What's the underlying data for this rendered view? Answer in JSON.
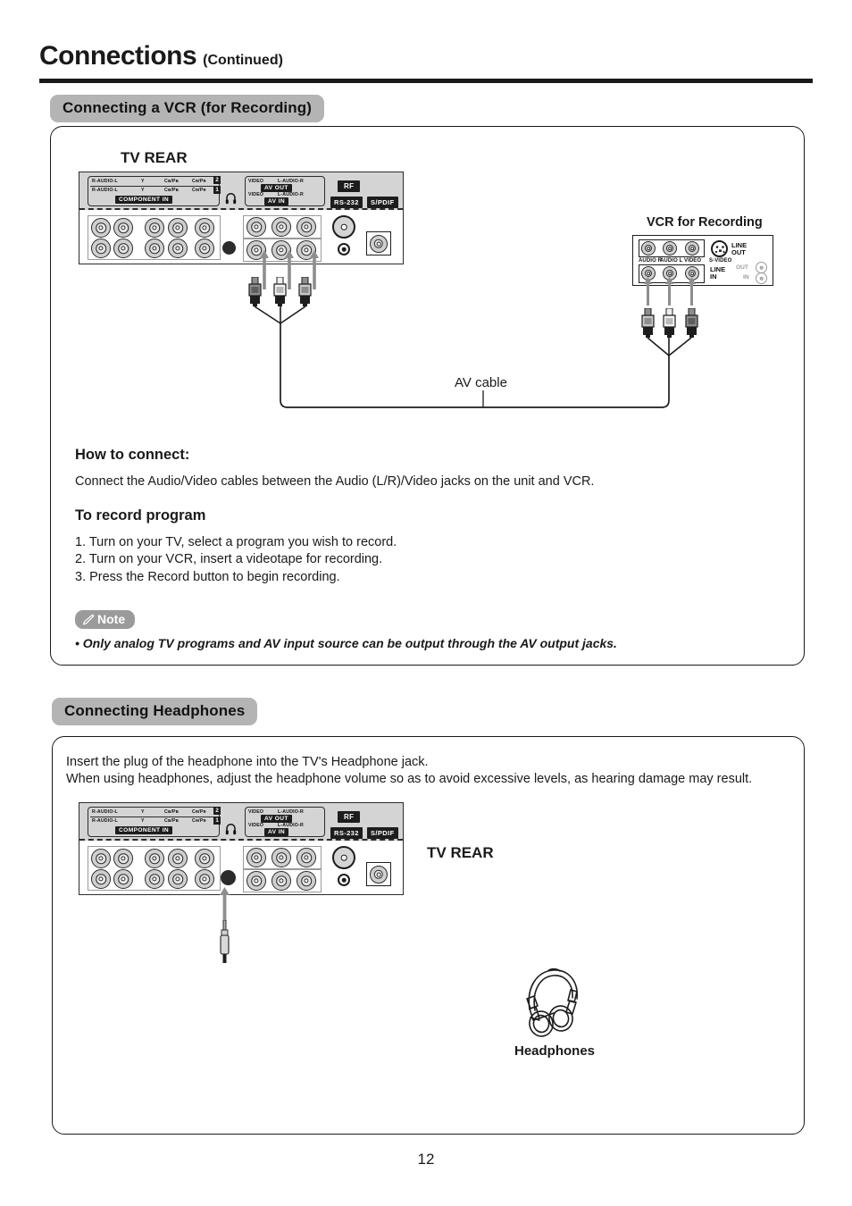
{
  "page": {
    "title_main": "Connections",
    "title_sub": "(Continued)",
    "number": "12"
  },
  "sections": [
    {
      "id": "vcr",
      "heading": "Connecting a VCR (for Recording)",
      "diagram": {
        "tv_label": "TV REAR",
        "vcr_label": "VCR for Recording",
        "cable_label": "AV cable"
      },
      "how_to_connect_heading": "How to connect:",
      "how_to_connect_body": "Connect the Audio/Video cables between the Audio (L/R)/Video jacks on the unit and VCR.",
      "record_heading": "To record program",
      "record_steps": [
        "1. Turn on your TV, select a program you wish to record.",
        "2. Turn on your VCR, insert a videotape for recording.",
        "3. Press the Record button to begin recording."
      ],
      "note_badge": "Note",
      "note_text": "• Only analog TV programs and AV input source can be output through the AV output jacks."
    },
    {
      "id": "headphones",
      "heading": "Connecting Headphones",
      "body_lines": [
        "Insert the plug of the headphone into the TV's Headphone jack.",
        "When using headphones, adjust the headphone volume so as to avoid excessive levels, as hearing damage may result."
      ],
      "diagram": {
        "tv_label": "TV REAR",
        "headphones_label": "Headphones"
      }
    }
  ],
  "tv_rear_panel": {
    "component_rows": [
      {
        "num": "2",
        "audio": "R-AUDIO-L",
        "y": "Y",
        "pb": "Cʙ/Pʙ",
        "pr": "Cʀ/Pʀ"
      },
      {
        "num": "1",
        "audio": "R-AUDIO-L",
        "y": "Y",
        "pb": "Cʙ/Pʙ",
        "pr": "Cʀ/Pʀ"
      }
    ],
    "component_tag": "COMPONENT IN",
    "av_rows": [
      {
        "video": "VIDEO",
        "audio": "L-AUDIO-R",
        "tag": "AV OUT"
      },
      {
        "video": "VIDEO",
        "audio": "L-AUDIO-R",
        "tag": "AV IN"
      }
    ],
    "rf_tag": "RF",
    "rs232_tag": "RS-232",
    "spdif_tag": "S/PDIF",
    "headphone_icon": "headphone-icon"
  },
  "vcr_panel": {
    "jack_labels": [
      "AUDIO R",
      "AUDIO L",
      "VIDEO"
    ],
    "svideo_label": "S-VIDEO",
    "line_out_label_1": "LINE",
    "line_out_label_2": "OUT",
    "line_in_label_1": "LINE",
    "line_in_label_2": "IN",
    "out_label": "OUT",
    "in_label": "IN"
  },
  "colors": {
    "pill_bg": "#b4b4b4",
    "note_bg": "#9b9b9b",
    "silk_bg": "#d4d4d4",
    "tag_bg": "#1d1d1d",
    "arrow_gray": "#8e8e8e",
    "text": "#1a1a1a"
  }
}
